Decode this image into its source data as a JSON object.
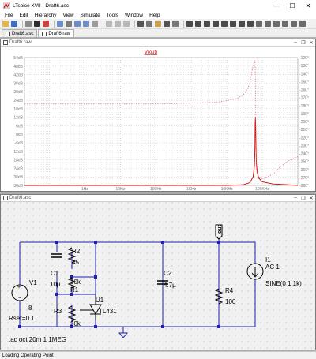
{
  "window": {
    "title": "LTspice XVII - Draft6.asc",
    "minimize": "—",
    "maximize": "☐",
    "close": "✕"
  },
  "menu": [
    "File",
    "Edit",
    "Hierarchy",
    "View",
    "Simulate",
    "Tools",
    "Window",
    "Help"
  ],
  "tabs": [
    {
      "label": "Draft6.asc",
      "active": false
    },
    {
      "label": "Draft6.raw",
      "active": true
    }
  ],
  "plot_window": {
    "title": "Draft6.raw",
    "trace_label": "V(out)"
  },
  "schematic_window": {
    "title": "Draft6.asc"
  },
  "chart_data": {
    "type": "line",
    "title": "",
    "trace": "V(out)",
    "xscale": "log",
    "xlim": [
      0.02,
      1000000
    ],
    "x_ticks": [
      "1Hz",
      "10Hz",
      "100Hz",
      "1KHz",
      "10KHz",
      "100KHz"
    ],
    "x_tick_values": [
      1,
      10,
      100,
      1000,
      10000,
      100000
    ],
    "y_left_ticks": [
      "54dB",
      "48dB",
      "42dB",
      "36dB",
      "30dB",
      "24dB",
      "18dB",
      "12dB",
      "6dB",
      "0dB",
      "-6dB",
      "-12dB",
      "-18dB",
      "-24dB",
      "-30dB",
      "-36dB"
    ],
    "y_left_values": [
      54,
      48,
      42,
      36,
      30,
      24,
      18,
      12,
      6,
      0,
      -6,
      -12,
      -18,
      -24,
      -30,
      -36
    ],
    "ylim_left": [
      -36,
      54
    ],
    "y_right_ticks": [
      "-120°",
      "-130°",
      "-140°",
      "-150°",
      "-160°",
      "-170°",
      "-180°",
      "-190°",
      "-200°",
      "-210°",
      "-220°",
      "-230°",
      "-240°",
      "-250°",
      "-260°",
      "-270°",
      "-280°"
    ],
    "y_right_values": [
      -120,
      -130,
      -140,
      -150,
      -160,
      -170,
      -180,
      -190,
      -200,
      -210,
      -220,
      -230,
      -240,
      -250,
      -260,
      -270,
      -280
    ],
    "ylim_right": [
      -280,
      -120
    ],
    "grid": true,
    "series": [
      {
        "quantity": "magnitude",
        "axis": "left",
        "style": "solid",
        "color": "#d20000",
        "x": [
          0.02,
          1,
          100,
          1000,
          10000,
          30000,
          45000,
          55000,
          60000,
          62000,
          63000,
          64000,
          65000,
          66000,
          68000,
          72000,
          80000,
          100000,
          200000,
          500000,
          1000000
        ],
        "y": [
          -36,
          -36,
          -36,
          -36,
          -36,
          -35.5,
          -34,
          -30,
          -22,
          -10,
          8,
          12,
          6,
          -6,
          -20,
          -27,
          -31,
          -33.5,
          -35,
          -35.5,
          -36
        ]
      },
      {
        "quantity": "phase",
        "axis": "right",
        "style": "dashed",
        "color": "#e07070",
        "x": [
          0.02,
          1,
          100,
          1000,
          5000,
          10000,
          20000,
          30000,
          40000,
          45000,
          50000,
          55000,
          60000,
          62000,
          63000,
          64000,
          65000,
          66000,
          68000,
          75000,
          100000,
          200000,
          300000,
          500000,
          1000000
        ],
        "y": [
          -178,
          -178,
          -178,
          -177,
          -176,
          -174,
          -171,
          -166,
          -158,
          -150,
          -140,
          -130,
          -124,
          -124,
          -130,
          -150,
          -200,
          -235,
          -260,
          -268,
          -272,
          -266,
          -258,
          -250,
          -244
        ]
      }
    ]
  },
  "schematic": {
    "components": [
      {
        "ref": "V1",
        "value": "8",
        "extra": "Rser=0.1"
      },
      {
        "ref": "C1",
        "value": "10µ"
      },
      {
        "ref": "R2",
        "value": "45"
      },
      {
        "ref": "R1",
        "value": "30k"
      },
      {
        "ref": "R3",
        "value": "30k"
      },
      {
        "ref": "U1",
        "value": "TL431"
      },
      {
        "ref": "C2",
        "value": "4.7µ"
      },
      {
        "ref": "R4",
        "value": "100"
      },
      {
        "ref": "I1",
        "value": "AC 1",
        "extra": "SINE(0 1 1k)"
      }
    ],
    "net_label": "out",
    "directive": ".ac oct 20m 1 1MEG"
  },
  "status": "Loading Operating Point"
}
